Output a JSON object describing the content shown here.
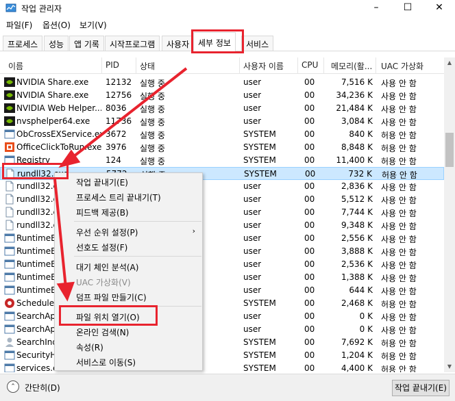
{
  "window": {
    "title": "작업 관리자",
    "minimize": "–",
    "maximize": "☐",
    "close": "✕"
  },
  "menu": [
    "파일(F)",
    "옵션(O)",
    "보기(V)"
  ],
  "tabs": [
    "프로세스",
    "성능",
    "앱 기록",
    "시작프로그램",
    "사용자",
    "세부 정보",
    "서비스"
  ],
  "active_tab": "세부 정보",
  "columns": [
    "이름",
    "PID",
    "상태",
    "사용자 이름",
    "CPU",
    "메모리(활...",
    "UAC 가상화"
  ],
  "rows": [
    {
      "name": "NVIDIA Share.exe",
      "pid": "12132",
      "status": "실행 중",
      "user": "user",
      "cpu": "00",
      "mem": "7,516 K",
      "uac": "사용 안 함",
      "icon": "nvidia-icon"
    },
    {
      "name": "NVIDIA Share.exe",
      "pid": "12756",
      "status": "실행 중",
      "user": "user",
      "cpu": "00",
      "mem": "34,236 K",
      "uac": "사용 안 함",
      "icon": "nvidia-icon"
    },
    {
      "name": "NVIDIA Web Helper....",
      "pid": "8036",
      "status": "실행 중",
      "user": "user",
      "cpu": "00",
      "mem": "21,484 K",
      "uac": "사용 안 함",
      "icon": "nvidia-icon"
    },
    {
      "name": "nvsphelper64.exe",
      "pid": "11736",
      "status": "실행 중",
      "user": "user",
      "cpu": "00",
      "mem": "3,084 K",
      "uac": "사용 안 함",
      "icon": "nvidia-icon"
    },
    {
      "name": "ObCrossEXService.exe",
      "pid": "3672",
      "status": "실행 중",
      "user": "SYSTEM",
      "cpu": "00",
      "mem": "840 K",
      "uac": "허용 안 함",
      "icon": "service-icon"
    },
    {
      "name": "OfficeClickToRun.exe",
      "pid": "3976",
      "status": "실행 중",
      "user": "SYSTEM",
      "cpu": "00",
      "mem": "8,848 K",
      "uac": "허용 안 함",
      "icon": "office-icon"
    },
    {
      "name": "Registry",
      "pid": "124",
      "status": "실행 중",
      "user": "SYSTEM",
      "cpu": "00",
      "mem": "11,400 K",
      "uac": "허용 안 함",
      "icon": "service-icon"
    },
    {
      "name": "rundll32.exe",
      "pid": "5772",
      "status": "실행 중",
      "user": "SYSTEM",
      "cpu": "00",
      "mem": "732 K",
      "uac": "허용 안 함",
      "icon": "file-icon"
    },
    {
      "name": "rundll32.exe",
      "pid": "",
      "status": "",
      "user": "user",
      "cpu": "00",
      "mem": "2,836 K",
      "uac": "사용 안 함",
      "icon": "file-icon"
    },
    {
      "name": "rundll32.exe",
      "pid": "",
      "status": "",
      "user": "user",
      "cpu": "00",
      "mem": "5,512 K",
      "uac": "사용 안 함",
      "icon": "file-icon"
    },
    {
      "name": "rundll32.exe",
      "pid": "",
      "status": "",
      "user": "user",
      "cpu": "00",
      "mem": "7,744 K",
      "uac": "사용 안 함",
      "icon": "file-icon"
    },
    {
      "name": "rundll32.exe",
      "pid": "",
      "status": "",
      "user": "user",
      "cpu": "00",
      "mem": "9,348 K",
      "uac": "사용 안 함",
      "icon": "file-icon"
    },
    {
      "name": "RuntimeBroker.exe",
      "pid": "",
      "status": "",
      "user": "user",
      "cpu": "00",
      "mem": "2,556 K",
      "uac": "사용 안 함",
      "icon": "service-icon"
    },
    {
      "name": "RuntimeBroker.exe",
      "pid": "",
      "status": "",
      "user": "user",
      "cpu": "00",
      "mem": "3,888 K",
      "uac": "사용 안 함",
      "icon": "service-icon"
    },
    {
      "name": "RuntimeBroker.exe",
      "pid": "",
      "status": "",
      "user": "user",
      "cpu": "00",
      "mem": "2,536 K",
      "uac": "사용 안 함",
      "icon": "service-icon"
    },
    {
      "name": "RuntimeBroker.exe",
      "pid": "",
      "status": "",
      "user": "user",
      "cpu": "00",
      "mem": "1,388 K",
      "uac": "사용 안 함",
      "icon": "service-icon"
    },
    {
      "name": "RuntimeBroker.exe",
      "pid": "",
      "status": "",
      "user": "user",
      "cpu": "00",
      "mem": "644 K",
      "uac": "사용 안 함",
      "icon": "service-icon"
    },
    {
      "name": "Scheduler.exe",
      "pid": "",
      "status": "",
      "user": "SYSTEM",
      "cpu": "00",
      "mem": "2,468 K",
      "uac": "허용 안 함",
      "icon": "scheduler-icon"
    },
    {
      "name": "SearchApp.exe",
      "pid": "",
      "status": "",
      "user": "user",
      "cpu": "00",
      "mem": "0 K",
      "uac": "사용 안 함",
      "icon": "service-icon"
    },
    {
      "name": "SearchApp.exe",
      "pid": "",
      "status": "",
      "user": "user",
      "cpu": "00",
      "mem": "0 K",
      "uac": "사용 안 함",
      "icon": "service-icon"
    },
    {
      "name": "SearchIndexer.exe",
      "pid": "",
      "status": "",
      "user": "SYSTEM",
      "cpu": "00",
      "mem": "7,692 K",
      "uac": "허용 안 함",
      "icon": "search-indexer-icon"
    },
    {
      "name": "SecurityHealth.exe",
      "pid": "",
      "status": "",
      "user": "SYSTEM",
      "cpu": "00",
      "mem": "1,204 K",
      "uac": "허용 안 함",
      "icon": "service-icon"
    },
    {
      "name": "services.exe",
      "pid": "",
      "status": "",
      "user": "SYSTEM",
      "cpu": "00",
      "mem": "4,400 K",
      "uac": "허용 안 함",
      "icon": "service-icon"
    }
  ],
  "context_menu": [
    {
      "label": "작업 끝내기(E)"
    },
    {
      "label": "프로세스 트리 끝내기(T)"
    },
    {
      "label": "피드백 제공(B)"
    },
    {
      "label": "우선 순위 설정(P)",
      "submenu": "›"
    },
    {
      "label": "선호도 설정(F)"
    },
    {
      "label": "대기 체인 분석(A)"
    },
    {
      "label": "UAC 가상화(V)",
      "disabled": true
    },
    {
      "label": "덤프 파일 만들기(C)"
    },
    {
      "label": "파일 위치 열기(O)"
    },
    {
      "label": "온라인 검색(N)"
    },
    {
      "label": "속성(R)"
    },
    {
      "label": "서비스로 이동(S)"
    }
  ],
  "bottom": {
    "less_details": "간단히(D)",
    "end_task": "작업 끝내기(E)"
  },
  "colors": {
    "annotation_red": "#e8232e",
    "selected_row": "#cce8ff",
    "menu_bg": "#f2f2f2"
  }
}
